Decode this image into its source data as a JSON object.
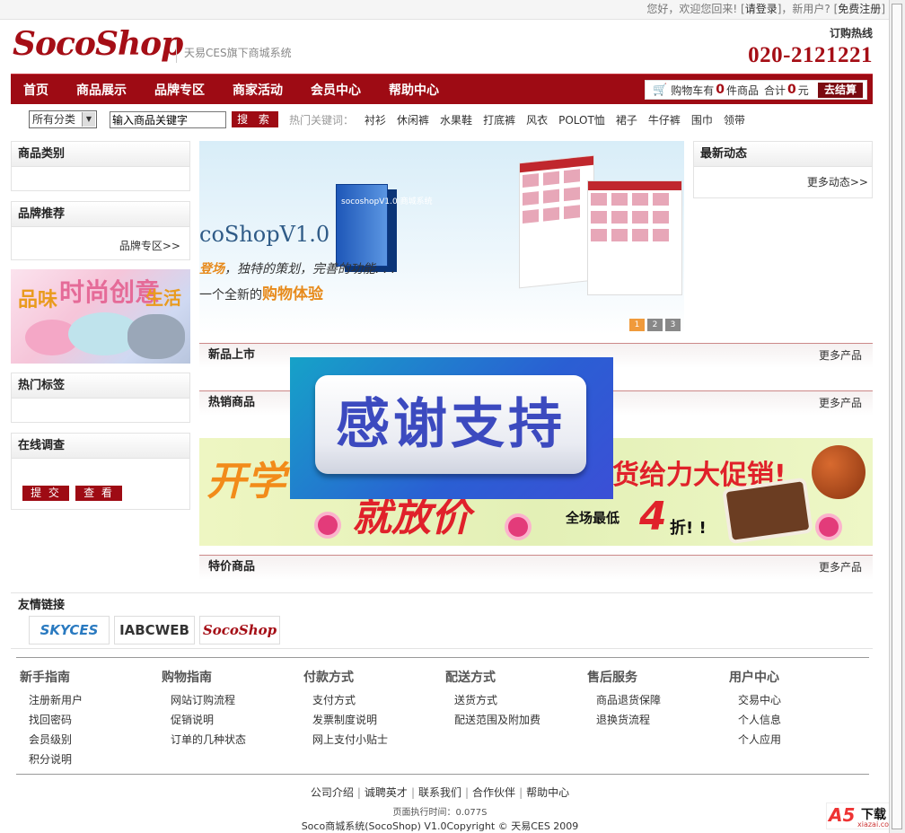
{
  "topbar": {
    "greeting": "您好，欢迎您回来! [",
    "login": "请登录",
    "mid": "]，新用户? [",
    "register": "免费注册",
    "end": "]"
  },
  "header": {
    "logo": "SocoShop",
    "slogan": "天易CES旗下商城系统",
    "hotline_label": "订购热线",
    "hotline": "020-2121221"
  },
  "nav": {
    "items": [
      "首页",
      "商品展示",
      "品牌专区",
      "商家活动",
      "会员中心",
      "帮助中心"
    ]
  },
  "cart": {
    "label": "购物车有",
    "count": "0",
    "unit": "件商品",
    "total_label": "合计",
    "total": "0",
    "currency": "元",
    "checkout": "去结算"
  },
  "search": {
    "category": "所有分类",
    "input_value": "输入商品关键字",
    "button": "搜 索",
    "hot_label": "热门关键词：",
    "keywords": [
      "衬衫",
      "休闲裤",
      "水果鞋",
      "打底裤",
      "风衣",
      "POLOT恤",
      "裙子",
      "牛仔裤",
      "围巾",
      "领带"
    ]
  },
  "sidebar": {
    "category_title": "商品类别",
    "brand_title": "品牌推荐",
    "brand_more": "品牌专区>>",
    "promo": {
      "a": "品味",
      "b": "时尚创意",
      "c": "生活"
    },
    "tags_title": "热门标签",
    "survey_title": "在线调查",
    "survey_submit": "提 交",
    "survey_view": "查 看"
  },
  "news": {
    "title": "最新动态",
    "more": "更多动态>>"
  },
  "banner": {
    "title": "coShopV1.0",
    "sub1_a": "登场",
    "sub1_b": "，独特的策划，完善的功能. . .",
    "sub2_a": "一个全新的",
    "sub2_b": "购物体验",
    "box_text": "socoshopV1.0 商城系统",
    "dots": [
      "1",
      "2",
      "3"
    ]
  },
  "sections": {
    "new": {
      "title": "新品上市",
      "more": "更多产品"
    },
    "hot": {
      "title": "热销商品",
      "more": "更多产品"
    },
    "special": {
      "title": "特价商品",
      "more": "更多产品"
    }
  },
  "sale": {
    "k1": "开学",
    "k2": "就放价",
    "k3": "货给力大促销!",
    "k4": "全场最低",
    "k5": "4",
    "k6": "折! !"
  },
  "overlay": {
    "text": "感谢支持"
  },
  "friends": {
    "title": "友情链接",
    "logos": [
      "SKYCES",
      "IABCWEB",
      "SocoShop"
    ]
  },
  "footer": {
    "columns": [
      {
        "title": "新手指南",
        "items": [
          "注册新用户",
          "找回密码",
          "会员级别",
          "积分说明"
        ]
      },
      {
        "title": "购物指南",
        "items": [
          "网站订购流程",
          "促销说明",
          "订单的几种状态"
        ]
      },
      {
        "title": "付款方式",
        "items": [
          "支付方式",
          "发票制度说明",
          "网上支付小贴士"
        ]
      },
      {
        "title": "配送方式",
        "items": [
          "送货方式",
          "配送范围及附加费"
        ]
      },
      {
        "title": "售后服务",
        "items": [
          "商品退货保障",
          "退换货流程"
        ]
      },
      {
        "title": "用户中心",
        "items": [
          "交易中心",
          "个人信息",
          "个人应用"
        ]
      }
    ],
    "links": [
      "公司介绍",
      "诚聘英才",
      "联系我们",
      "合作伙伴",
      "帮助中心"
    ],
    "exec_time": "页面执行时间：0.077S",
    "copyright": "Soco商城系统(SocoShop) V1.0Copyright © 天易CES 2009"
  },
  "watermark": {
    "a5": "A5",
    "dl": "下载",
    "site": "xiazai.com"
  }
}
